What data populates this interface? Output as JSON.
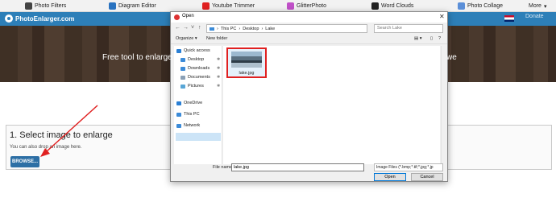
{
  "topbar": {
    "items": [
      {
        "label": "Photo Filters",
        "icon": "photo-filters-icon",
        "color": "#444444"
      },
      {
        "label": "Diagram Editor",
        "icon": "diagram-editor-icon",
        "color": "#2a73c0"
      },
      {
        "label": "Youtube Trimmer",
        "icon": "youtube-icon",
        "color": "#e02020"
      },
      {
        "label": "GlitterPhoto",
        "icon": "glitter-icon",
        "color": "#c050c8"
      },
      {
        "label": "Word Clouds",
        "icon": "word-clouds-icon",
        "color": "#222222"
      },
      {
        "label": "Photo Collage",
        "icon": "photo-collage-icon",
        "color": "#5b8fd8"
      },
      {
        "label": "More",
        "icon": "chevron-down-icon",
        "color": "#444444"
      }
    ]
  },
  "header": {
    "logo": "PhotoEnlarger.com",
    "donate": "Donate",
    "brand_color": "#2d7fb8"
  },
  "hero": {
    "text_left": "Free tool to enlarge y",
    "text_right": "we"
  },
  "panel": {
    "title": "1. Select image to enlarge",
    "subtitle": "You can also drop an image here.",
    "browse_label": "BROWSE..."
  },
  "dialog": {
    "title": "Open",
    "breadcrumb": [
      "This PC",
      "Desktop",
      "Lake"
    ],
    "search_placeholder": "Search Lake",
    "organize": "Organize",
    "new_folder": "New folder",
    "nav": [
      {
        "label": "Quick access",
        "icon": "star-icon",
        "color": "#2a7fd4"
      },
      {
        "label": "Desktop",
        "icon": "desktop-icon",
        "color": "#3c8bd8"
      },
      {
        "label": "Downloads",
        "icon": "downloads-icon",
        "color": "#3c8bd8"
      },
      {
        "label": "Documents",
        "icon": "documents-icon",
        "color": "#8aa0b6"
      },
      {
        "label": "Pictures",
        "icon": "pictures-icon",
        "color": "#58a6d6"
      },
      {
        "label": "OneDrive",
        "icon": "onedrive-icon",
        "color": "#2a7fd4"
      },
      {
        "label": "This PC",
        "icon": "this-pc-icon",
        "color": "#3c8bd8"
      },
      {
        "label": "Network",
        "icon": "network-icon",
        "color": "#3c8bd8"
      }
    ],
    "file": {
      "name": "lake.jpg"
    },
    "filename_label": "File name:",
    "filename_value": "lake.jpg",
    "filter": "Image Files (*.bmp;*.tif;*.jpg;*.jp",
    "open_label": "Open",
    "cancel_label": "Cancel"
  },
  "annotation_color": "#e02020"
}
